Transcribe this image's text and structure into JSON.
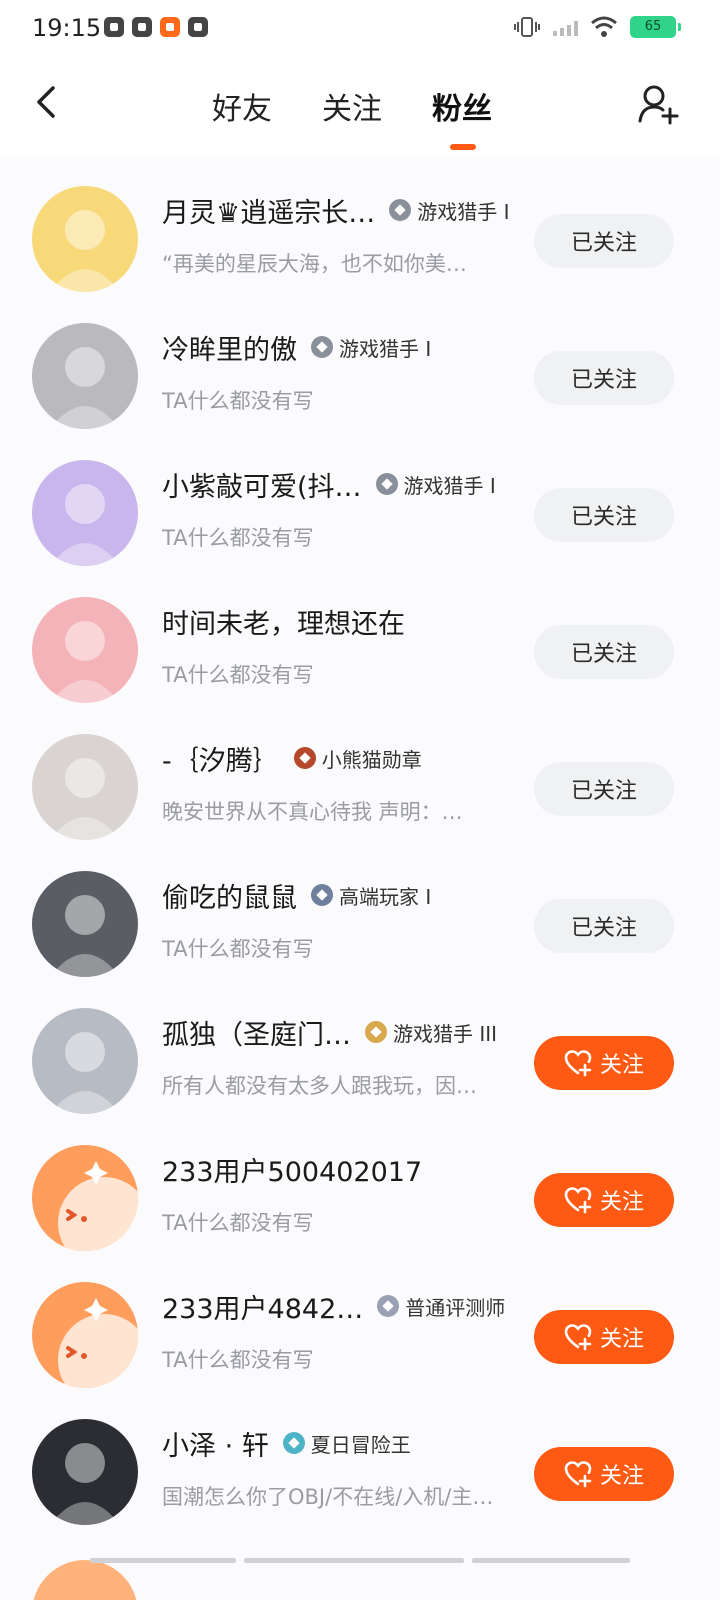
{
  "status_bar": {
    "time": "19:15",
    "battery": "65",
    "app_icons": [
      "app-icon-1",
      "video-app-icon",
      "kuaishou-app-icon",
      "music-app-icon"
    ]
  },
  "nav": {
    "tabs": [
      {
        "label": "好友"
      },
      {
        "label": "关注"
      },
      {
        "label": "粉丝",
        "active": true
      }
    ]
  },
  "colors": {
    "accent": "#ff5a14",
    "followed_bg": "#f0f1f3",
    "bio_text": "#9a9ca3"
  },
  "users": [
    {
      "name": "月灵♛逍遥宗长…",
      "badge": "游戏猎手 I",
      "badge_color": "#8a8f9c",
      "bio": "“再美的星辰大海，也不如你美…",
      "button": "已关注",
      "followed": true,
      "avatar_color": "#f7d97a"
    },
    {
      "name": "冷眸里的傲",
      "badge": "游戏猎手 I",
      "badge_color": "#8a8f9c",
      "bio": "TA什么都没有写",
      "button": "已关注",
      "followed": true,
      "avatar_color": "#b9b9be"
    },
    {
      "name": "小紫敲可爱(抖…",
      "badge": "游戏猎手 I",
      "badge_color": "#8a8f9c",
      "bio": "TA什么都没有写",
      "button": "已关注",
      "followed": true,
      "avatar_color": "#c9b6ec"
    },
    {
      "name": "时间未老，理想还在",
      "badge": "",
      "badge_color": "",
      "bio": "TA什么都没有写",
      "button": "已关注",
      "followed": true,
      "avatar_color": "#f4b3b8"
    },
    {
      "name": "-｛汐腾｝",
      "badge": "小熊猫勋章",
      "badge_color": "#b5482a",
      "bio": "晚安世界从不真心待我 声明：…",
      "button": "已关注",
      "followed": true,
      "avatar_color": "#d9d4d2"
    },
    {
      "name": "偷吃的鼠鼠",
      "badge": "高端玩家 I",
      "badge_color": "#6f7f9e",
      "bio": "TA什么都没有写",
      "button": "已关注",
      "followed": true,
      "avatar_color": "#5a5d63"
    },
    {
      "name": "孤独（圣庭门…",
      "badge": "游戏猎手 III",
      "badge_color": "#d9a94e",
      "bio": "所有人都没有太多人跟我玩，因…",
      "button": "关注",
      "followed": false,
      "avatar_color": "#b7bcc4"
    },
    {
      "name": "233用户500402017",
      "badge": "",
      "badge_color": "",
      "bio": "TA什么都没有写",
      "button": "关注",
      "followed": false,
      "avatar_color": "#ff9d5c"
    },
    {
      "name": "233用户4842…",
      "badge": "普通评测师",
      "badge_color": "#9aa0b3",
      "bio": "TA什么都没有写",
      "button": "关注",
      "followed": false,
      "avatar_color": "#ff9d5c"
    },
    {
      "name": "小泽 · 轩",
      "badge": "夏日冒险王",
      "badge_color": "#4fb3c7",
      "bio": "国潮怎么你了⁠OBJ/不在线/入机/主…",
      "button": "关注",
      "followed": false,
      "avatar_color": "#2b2d33"
    }
  ]
}
